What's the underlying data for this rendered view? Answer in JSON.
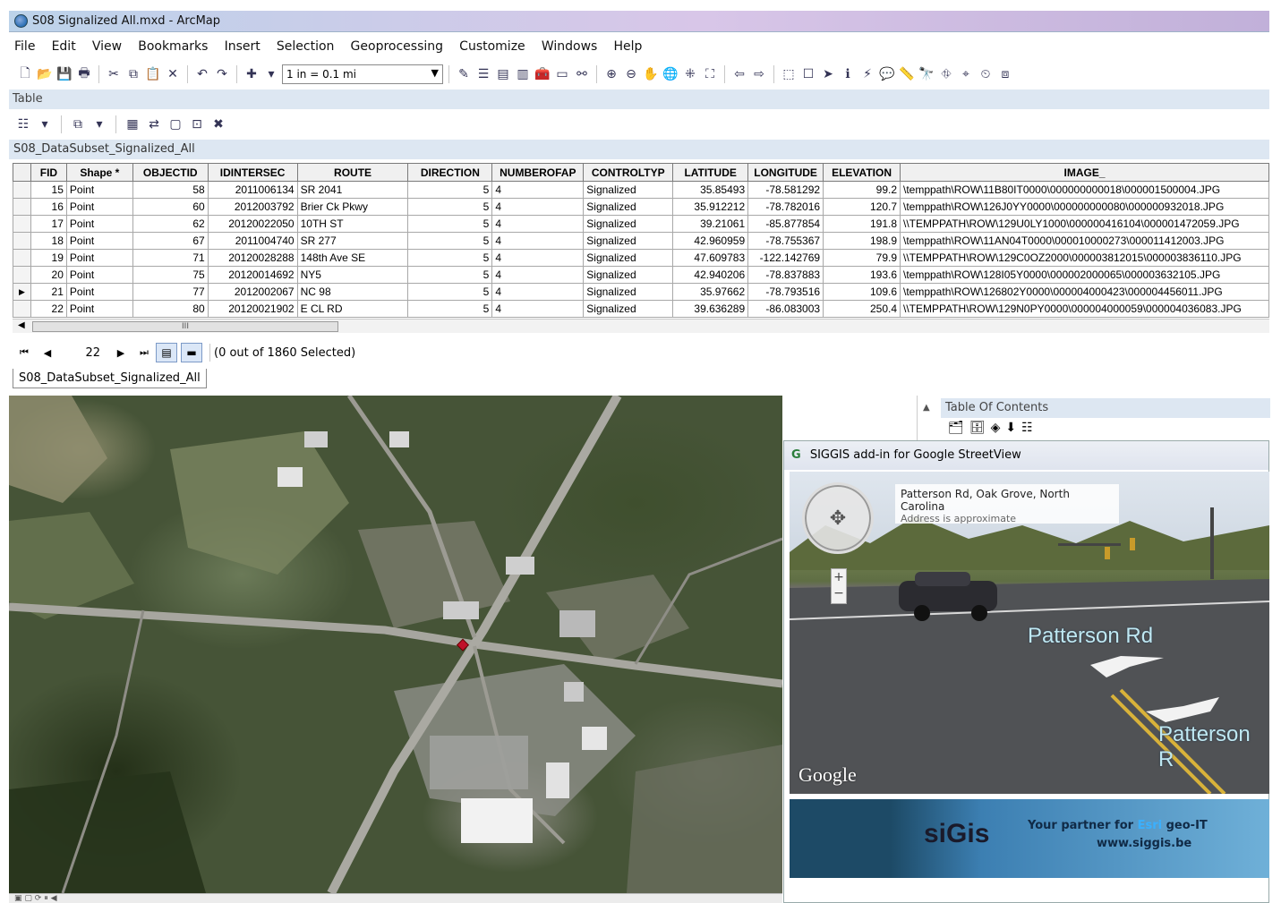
{
  "window": {
    "title": "S08 Signalized All.mxd - ArcMap"
  },
  "menu": [
    "File",
    "Edit",
    "View",
    "Bookmarks",
    "Insert",
    "Selection",
    "Geoprocessing",
    "Customize",
    "Windows",
    "Help"
  ],
  "toolbar": {
    "scale": "1 in = 0.1 mi"
  },
  "table_window": {
    "title": "Table",
    "layer_name": "S08_DataSubset_Signalized_All",
    "columns": [
      "FID",
      "Shape *",
      "OBJECTID",
      "IDINTERSEC",
      "ROUTE",
      "DIRECTION",
      "NUMBEROFAP",
      "CONTROLTYP",
      "LATITUDE",
      "LONGITUDE",
      "ELEVATION",
      "IMAGE_"
    ],
    "rows": [
      [
        "15",
        "Point",
        "58",
        "2011006134",
        "SR 2041",
        "5",
        "4",
        "Signalized",
        "35.85493",
        "-78.581292",
        "99.2",
        "\\temppath\\ROW\\11B80IT0000\\000000000018\\000001500004.JPG"
      ],
      [
        "16",
        "Point",
        "60",
        "2012003792",
        "Brier Ck Pkwy",
        "5",
        "4",
        "Signalized",
        "35.912212",
        "-78.782016",
        "120.7",
        "\\temppath\\ROW\\126J0YY0000\\000000000080\\000000932018.JPG"
      ],
      [
        "17",
        "Point",
        "62",
        "20120022050",
        "10TH ST",
        "5",
        "4",
        "Signalized",
        "39.21061",
        "-85.877854",
        "191.8",
        "\\\\TEMPPATH\\ROW\\129U0LY1000\\000000416104\\000001472059.JPG"
      ],
      [
        "18",
        "Point",
        "67",
        "2011004740",
        "SR 277",
        "5",
        "4",
        "Signalized",
        "42.960959",
        "-78.755367",
        "198.9",
        "\\temppath\\ROW\\11AN04T0000\\000010000273\\000011412003.JPG"
      ],
      [
        "19",
        "Point",
        "71",
        "20120028288",
        "148th Ave SE",
        "5",
        "4",
        "Signalized",
        "47.609783",
        "-122.142769",
        "79.9",
        "\\\\TEMPPATH\\ROW\\129C0OZ2000\\000003812015\\000003836110.JPG"
      ],
      [
        "20",
        "Point",
        "75",
        "20120014692",
        "NY5",
        "5",
        "4",
        "Signalized",
        "42.940206",
        "-78.837883",
        "193.6",
        "\\temppath\\ROW\\128I05Y0000\\000002000065\\000003632105.JPG"
      ],
      [
        "21",
        "Point",
        "77",
        "2012002067",
        "NC 98",
        "5",
        "4",
        "Signalized",
        "35.97662",
        "-78.793516",
        "109.6",
        "\\temppath\\ROW\\126802Y0000\\000004000423\\000004456011.JPG"
      ],
      [
        "22",
        "Point",
        "80",
        "20120021902",
        "E CL RD",
        "5",
        "4",
        "Signalized",
        "39.636289",
        "-86.083003",
        "250.4",
        "\\\\TEMPPATH\\ROW\\129N0PY0000\\000004000059\\000004036083.JPG"
      ]
    ],
    "current_row_index": 6,
    "scroll_thumb": "III",
    "record_number": "22",
    "selection_status": "(0 out of 1860 Selected)",
    "bottom_tab": "S08_DataSubset_Signalized_All"
  },
  "toc": {
    "title": "Table Of Contents"
  },
  "streetview": {
    "title": "SIGGIS add-in for Google StreetView",
    "address": "Patterson Rd, Oak Grove, North Carolina",
    "address_note": "Address is approximate",
    "street_label_1": "Patterson Rd",
    "street_label_2": "Patterson R",
    "google_logo": "Google",
    "banner": {
      "brand": "siGis",
      "slogan_prefix": "Your partner for ",
      "slogan_esri": "Esri",
      "slogan_suffix": " geo-IT",
      "site": "www.siggis.be"
    }
  },
  "colors": {
    "title_grad_start": "#bcd3ea",
    "panel_header": "#dde7f2",
    "map_marker": "#c0102a",
    "street_label": "#bfe8f2"
  }
}
